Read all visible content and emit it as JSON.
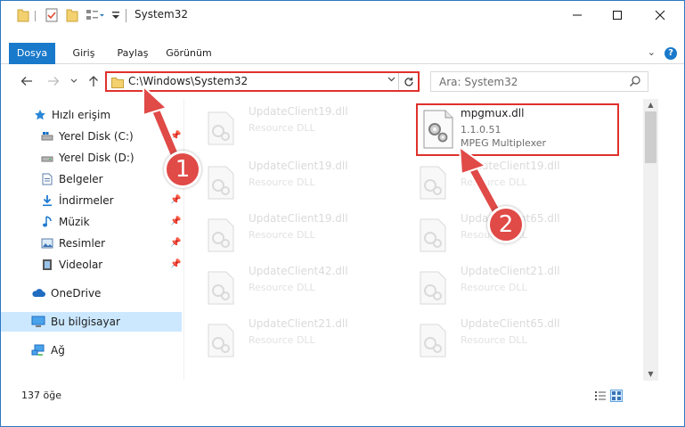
{
  "window": {
    "title": "System32"
  },
  "ribbon": {
    "tabs": [
      {
        "label": "Dosya"
      },
      {
        "label": "Giriş"
      },
      {
        "label": "Paylaş"
      },
      {
        "label": "Görünüm"
      }
    ]
  },
  "address": {
    "path": "C:\\Windows\\System32",
    "search_placeholder": "Ara: System32"
  },
  "sidebar": {
    "items": [
      {
        "label": "Hızlı erişim",
        "icon": "star-icon"
      },
      {
        "label": "Yerel Disk (C:)",
        "icon": "drive-icon"
      },
      {
        "label": "Yerel Disk (D:)",
        "icon": "drive-icon"
      },
      {
        "label": "Belgeler",
        "icon": "documents-icon"
      },
      {
        "label": "İndirmeler",
        "icon": "download-icon"
      },
      {
        "label": "Müzik",
        "icon": "music-icon"
      },
      {
        "label": "Resimler",
        "icon": "pictures-icon"
      },
      {
        "label": "Videolar",
        "icon": "video-icon"
      },
      {
        "label": "OneDrive",
        "icon": "cloud-icon"
      },
      {
        "label": "Bu bilgisayar",
        "icon": "computer-icon"
      },
      {
        "label": "Ağ",
        "icon": "network-icon"
      }
    ]
  },
  "files": {
    "highlighted": {
      "name": "mpgmux.dll",
      "version": "1.1.0.51",
      "description": "MPEG Multiplexer"
    },
    "left_column": [
      {
        "name": "UpdateClient19.dll",
        "type": "Resource DLL"
      },
      {
        "name": "UpdateClient19.dll",
        "type": "Resource DLL"
      },
      {
        "name": "UpdateClient19.dll",
        "type": "Resource DLL"
      },
      {
        "name": "UpdateClient42.dll",
        "type": "Resource DLL"
      },
      {
        "name": "UpdateClient21.dll",
        "type": "Resource DLL"
      }
    ],
    "right_column": [
      {
        "name": "UpdateClient19.dll",
        "type": "Resource DLL"
      },
      {
        "name": "UpdateClient65.dll",
        "type": "Resource DLL"
      },
      {
        "name": "UpdateClient21.dll",
        "type": "Resource DLL"
      },
      {
        "name": "UpdateClient65.dll",
        "type": "Resource DLL"
      }
    ]
  },
  "status": {
    "item_count": "137 öğe"
  },
  "annotations": {
    "step1": "1",
    "step2": "2",
    "color": "#e04a47"
  }
}
